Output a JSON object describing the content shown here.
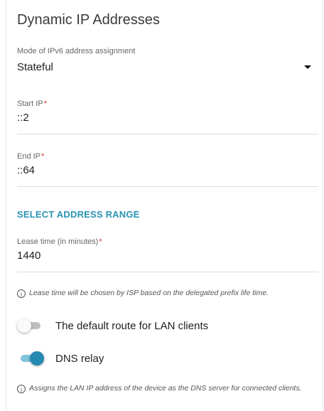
{
  "section_title": "Dynamic IP Addresses",
  "mode": {
    "label": "Mode of IPv6 address assignment",
    "value": "Stateful"
  },
  "start_ip": {
    "label": "Start IP",
    "required_mark": "*",
    "value": "::2"
  },
  "end_ip": {
    "label": "End IP",
    "required_mark": "*",
    "value": "::64"
  },
  "select_range_link": "SELECT ADDRESS RANGE",
  "lease_time": {
    "label": "Lease time (in minutes)",
    "required_mark": "*",
    "value": "1440"
  },
  "lease_hint": "Lease time will be chosen by ISP based on the delegated prefix life time.",
  "default_route_toggle": {
    "label": "The default route for LAN clients",
    "state": "off"
  },
  "dns_relay_toggle": {
    "label": "DNS relay",
    "state": "on"
  },
  "dns_hint": "Assigns the LAN IP address of the device as the DNS server for connected clients.",
  "info_icon_glyph": "i",
  "colors": {
    "accent": "#2689b2",
    "link": "#2a93b3",
    "required": "#e0312c"
  }
}
